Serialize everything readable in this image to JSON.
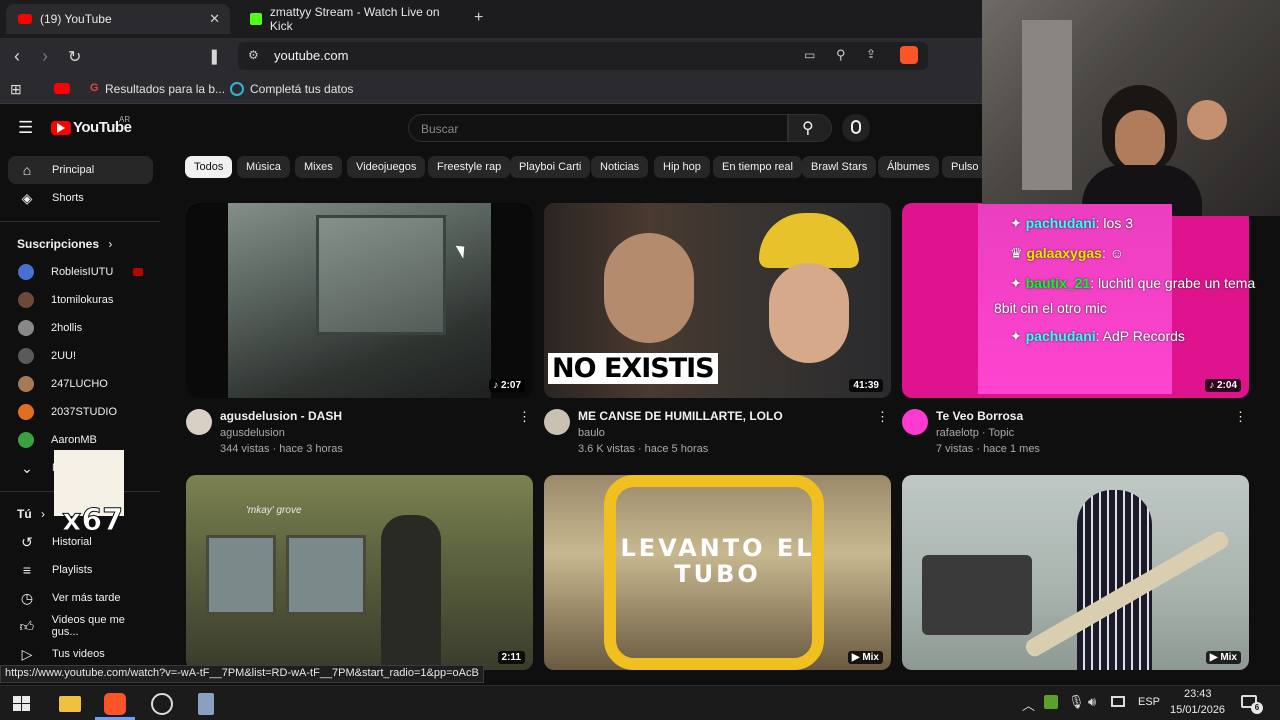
{
  "browser": {
    "tabs": [
      {
        "title": "(19) YouTube",
        "active": true
      },
      {
        "title": "zmattyy Stream - Watch Live on Kick",
        "active": false
      }
    ],
    "url": "youtube.com",
    "bookmarks": [
      "Resultados para la b...",
      "Completá tus datos"
    ],
    "status_url": "https://www.youtube.com/watch?v=-wA-tF__7PM&list=RD-wA-tF__7PM&start_radio=1&pp=oAcB"
  },
  "youtube": {
    "logo": "YouTube",
    "region": "AR",
    "search_placeholder": "Buscar",
    "sidebar": {
      "main": [
        {
          "label": "Principal",
          "icon": "home-icon"
        },
        {
          "label": "Shorts",
          "icon": "shorts-icon"
        }
      ],
      "subs_header": "Suscripciones",
      "subs": [
        {
          "label": "RobleisIUTU",
          "color": "#4a6fd0"
        },
        {
          "label": "1tomilokuras",
          "color": "#6b4a3a"
        },
        {
          "label": "2hollis",
          "color": "#888888"
        },
        {
          "label": "2UU!",
          "color": "#5a5a5a"
        },
        {
          "label": "247LUCHO",
          "color": "#a47a5a"
        },
        {
          "label": "2037STUDIO",
          "color": "#e07020"
        },
        {
          "label": "AaronMB",
          "color": "#3aa040"
        }
      ],
      "more_label": "M",
      "you_header": "Tú",
      "you": [
        {
          "label": "Historial",
          "icon": "history-icon"
        },
        {
          "label": "Playlists",
          "icon": "playlists-icon"
        },
        {
          "label": "Ver más tarde",
          "icon": "watch-later-icon"
        },
        {
          "label": "Videos que me gus...",
          "icon": "like-icon"
        },
        {
          "label": "Tus videos",
          "icon": "your-videos-icon"
        }
      ]
    },
    "chips": [
      "Todos",
      "Música",
      "Mixes",
      "Videojuegos",
      "Freestyle rap",
      "Playboi Carti",
      "Noticias",
      "Hip hop",
      "En tiempo real",
      "Brawl Stars",
      "Álbumes",
      "Pulso"
    ],
    "videos": [
      {
        "title": "agusdelusion - DASH",
        "channel": "agusdelusion",
        "meta": "344 vistas · hace 3 horas",
        "duration": "2:07"
      },
      {
        "title": "ME CANSE DE HUMILLARTE, LOLO",
        "channel": "baulo",
        "meta": "3.6 K vistas · hace 5 horas",
        "duration": "41:39",
        "overlay": "NO EXISTIS"
      },
      {
        "title": "Te Veo Borrosa",
        "channel": "rafaelotp · Topic",
        "meta": "7 vistas · hace 1 mes",
        "duration": "2:04"
      },
      {
        "duration": "2:11",
        "overlay": "'mkay' grove"
      },
      {
        "duration": "Mix",
        "overlay": "LEVANTO EL TUBO"
      },
      {
        "duration": "Mix"
      }
    ]
  },
  "stream_overlay": {
    "chat": [
      {
        "user": "pachudani",
        "msg": "los 3"
      },
      {
        "user": "galaaxygas",
        "msg": ""
      },
      {
        "user": "bautix_21",
        "msg": "luchitl que grabe un tema"
      },
      {
        "user": "",
        "msg": "8bit cin el otro mic"
      },
      {
        "user": "pachudani",
        "msg": "AdP Records"
      }
    ],
    "badge": "x67"
  },
  "taskbar": {
    "lang": "ESP",
    "time": "23:43",
    "date": "15/01/2026",
    "notifications": "6"
  }
}
